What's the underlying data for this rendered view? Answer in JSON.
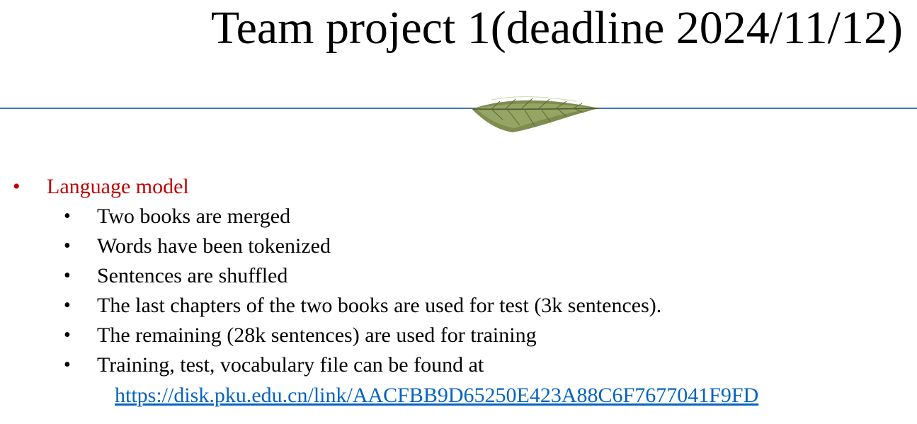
{
  "title": "Team project 1(deadline 2024/11/12)",
  "colors": {
    "divider": "#4472C4",
    "heading": "#C00000",
    "link": "#0563C1"
  },
  "decoration": "leaf-ornament",
  "section": {
    "bullet": "•",
    "heading": "Language model",
    "items": [
      "Two books are merged",
      "Words have been tokenized",
      "Sentences are shuffled",
      "The last chapters of the two books are used for test (3k sentences).",
      "The remaining (28k sentences) are used for training",
      "Training, test, vocabulary file can be found at"
    ],
    "link": "https://disk.pku.edu.cn/link/AACFBB9D65250E423A88C6F7677041F9FD"
  }
}
